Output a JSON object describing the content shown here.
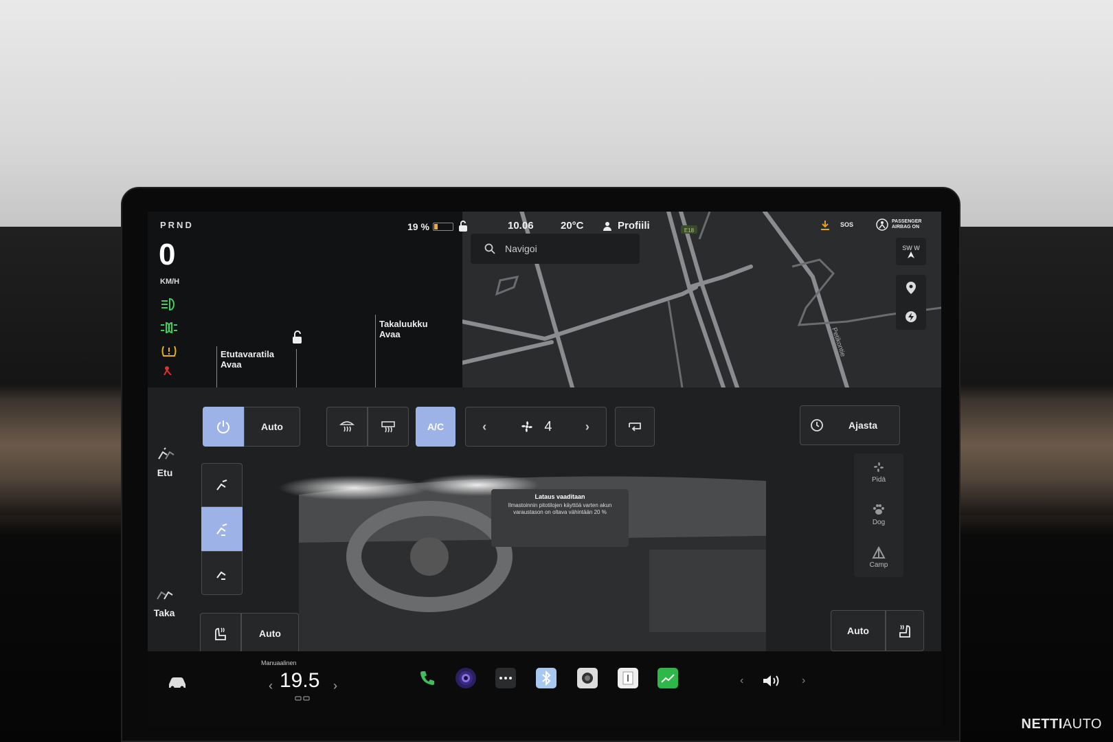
{
  "status": {
    "gear": "PRND",
    "speed": "0",
    "speed_unit": "KM/H",
    "battery_pct": "19 %",
    "battery_level": 0.19,
    "time": "10.06",
    "temperature": "20°C",
    "profile": "Profiili",
    "sos": "SOS",
    "airbag_line1": "PASSENGER",
    "airbag_line2": "AIRBAG ON"
  },
  "trunk": {
    "front_title": "Etutavaratila",
    "front_action": "Avaa",
    "rear_title": "Takaluukku",
    "rear_action": "Avaa"
  },
  "map": {
    "search_placeholder": "Navigoi",
    "compass_a": "SW",
    "compass_b": "W",
    "road_badge": "E18",
    "street_label": "Petikontie"
  },
  "climate": {
    "power_auto": "Auto",
    "ac_label": "A/C",
    "fan_speed": "4",
    "schedule_label": "Ajasta",
    "front_label": "Etu",
    "rear_label": "Taka",
    "seat_auto_left": "Auto",
    "seat_auto_right": "Auto",
    "modes": [
      {
        "label": "Pidä"
      },
      {
        "label": "Dog"
      },
      {
        "label": "Camp"
      }
    ],
    "notice_title": "Lataus vaaditaan",
    "notice_body": "Ilmastoinnin pitotilojen käyttöä varten akun varaustason on oltava vähintään 20 %"
  },
  "bottom": {
    "temp_mode": "Manuaalinen",
    "temp_value": "19.5"
  },
  "watermark": {
    "bold": "NETTI",
    "light": "AUTO"
  },
  "colors": {
    "accent": "#9db3e8",
    "phone": "#3fbf5a",
    "chart": "#2fb84a"
  }
}
